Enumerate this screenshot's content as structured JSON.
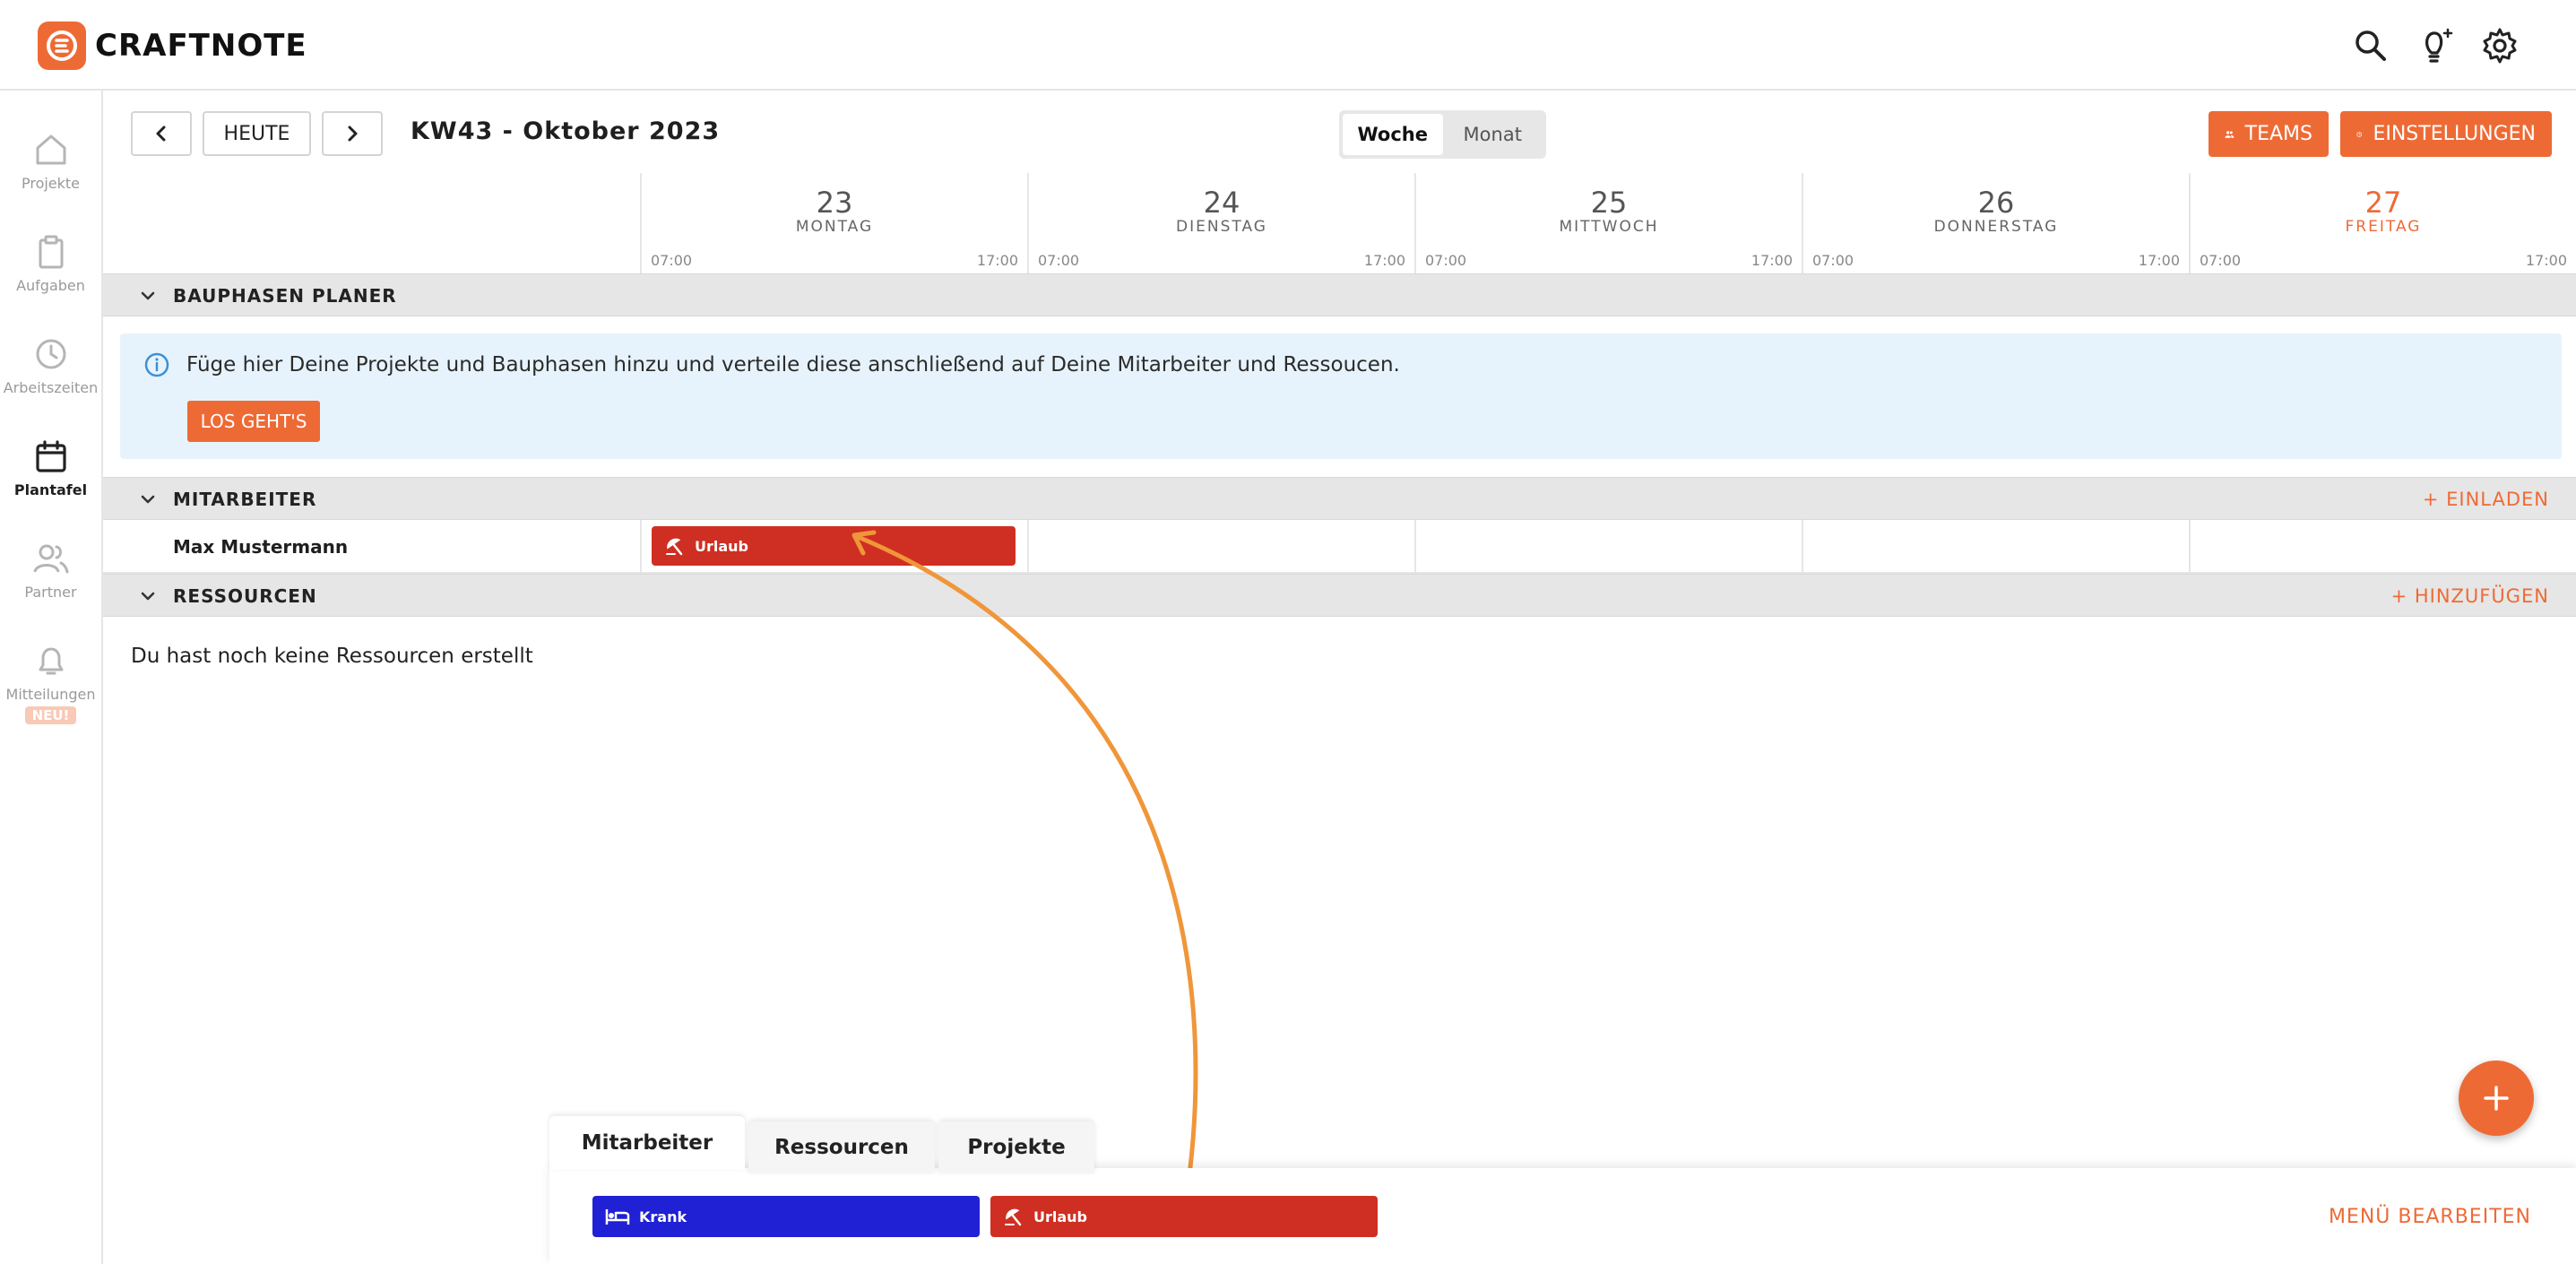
{
  "brand": {
    "name": "CRAFTNOTE",
    "accent": "#ee6a35"
  },
  "topbar": {
    "icons": [
      "search-icon",
      "lightbulb-icon",
      "gear-icon"
    ]
  },
  "sidebar": {
    "items": [
      {
        "label": "Projekte",
        "icon": "home-icon"
      },
      {
        "label": "Aufgaben",
        "icon": "clipboard-icon"
      },
      {
        "label": "Arbeitszeiten",
        "icon": "clock-icon"
      },
      {
        "label": "Plantafel",
        "icon": "calendar-icon",
        "active": true
      },
      {
        "label": "Partner",
        "icon": "users-icon"
      },
      {
        "label": "Mitteilungen",
        "icon": "bell-icon",
        "badge": "NEU!"
      }
    ]
  },
  "toolbar": {
    "today_label": "HEUTE",
    "week_title": "KW43 - Oktober 2023",
    "view_week": "Woche",
    "view_month": "Monat",
    "teams_label": "TEAMS",
    "settings_label": "EINSTELLUNGEN"
  },
  "days": [
    {
      "num": "23",
      "name": "MONTAG",
      "start": "07:00",
      "end": "17:00"
    },
    {
      "num": "24",
      "name": "DIENSTAG",
      "start": "07:00",
      "end": "17:00"
    },
    {
      "num": "25",
      "name": "MITTWOCH",
      "start": "07:00",
      "end": "17:00"
    },
    {
      "num": "26",
      "name": "DONNERSTAG",
      "start": "07:00",
      "end": "17:00"
    },
    {
      "num": "27",
      "name": "FREITAG",
      "start": "07:00",
      "end": "17:00",
      "today": true
    }
  ],
  "sections": {
    "bauphasen": {
      "title": "BAUPHASEN PLANER"
    },
    "mitarbeiter": {
      "title": "MITARBEITER",
      "action": "+ EINLADEN"
    },
    "ressourcen": {
      "title": "RESSOURCEN",
      "action": "+ HINZUFÜGEN"
    }
  },
  "info": {
    "text": "Füge hier Deine Projekte und Bauphasen hinzu und verteile diese anschließend auf Deine Mitarbeiter und Ressoucen.",
    "button": "LOS GEHT'S"
  },
  "employee": {
    "name": "Max Mustermann",
    "entry": "Urlaub",
    "entry_color": "#cf2f22"
  },
  "ressourcen_empty": "Du hast noch keine Ressourcen erstellt",
  "drawer": {
    "tabs": [
      "Mitarbeiter",
      "Ressourcen",
      "Projekte"
    ],
    "chips": [
      {
        "label": "Krank",
        "color": "#2020d4",
        "icon": "bed-icon"
      },
      {
        "label": "Urlaub",
        "color": "#cf2f22",
        "icon": "umbrella-icon"
      }
    ],
    "menu_edit": "MENÜ BEARBEITEN"
  }
}
